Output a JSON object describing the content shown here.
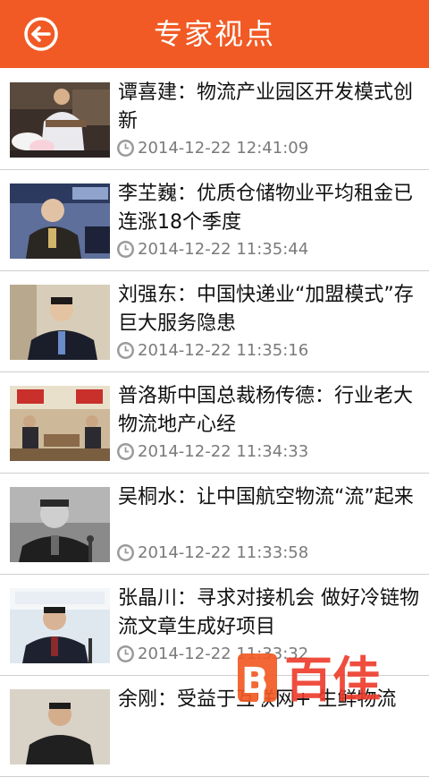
{
  "header": {
    "title": "专家视点",
    "back_icon": "back-arrow-circle-icon",
    "color": "#f15a24"
  },
  "articles": [
    {
      "title": "谭喜建：物流产业园区开发模式创新",
      "time": "2014-12-22 12:41:09"
    },
    {
      "title": "李芏巍：优质仓储物业平均租金已连涨18个季度",
      "time": "2014-12-22 11:35:44"
    },
    {
      "title": "刘强东：中国快递业“加盟模式”存巨大服务隐患",
      "time": "2014-12-22 11:35:16"
    },
    {
      "title": "普洛斯中国总裁杨传德：行业老大物流地产心经",
      "time": "2014-12-22 11:34:33"
    },
    {
      "title": "吴桐水：让中国航空物流“流”起来",
      "time": "2014-12-22 11:33:58"
    },
    {
      "title": "张晶川：寻求对接机会 做好冷链物流文章生成好项目",
      "time": "2014-12-22 11:33:32"
    },
    {
      "title": "余刚：受益于互联网+ 生鲜物流",
      "time": ""
    }
  ],
  "watermark": {
    "text": "百佳"
  }
}
